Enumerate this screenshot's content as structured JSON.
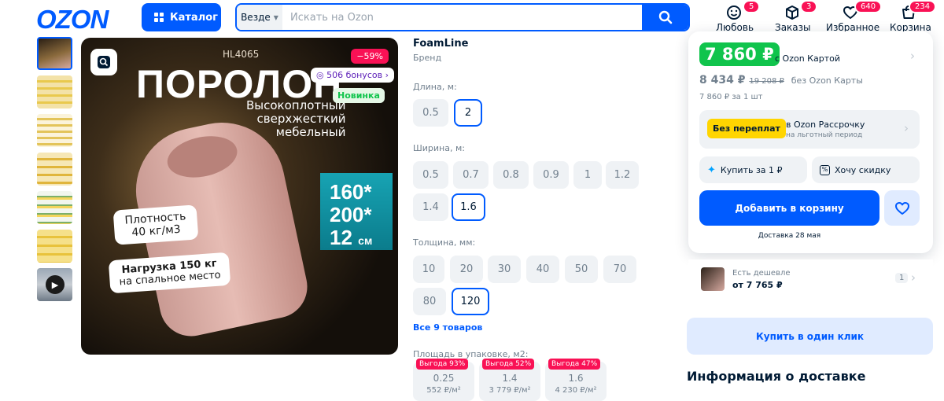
{
  "header": {
    "logo": "OZON",
    "catalog_label": "Каталог",
    "search_scope": "Везде",
    "search_placeholder": "Искать на Ozon",
    "actions": [
      {
        "label": "Любовь",
        "badge": "5",
        "icon": "smile-icon"
      },
      {
        "label": "Заказы",
        "badge": "3",
        "icon": "box-icon"
      },
      {
        "label": "Избранное",
        "badge": "640",
        "icon": "heart-icon"
      },
      {
        "label": "Корзина",
        "badge": "234",
        "icon": "cart-icon"
      }
    ]
  },
  "hero": {
    "code": "HL4065",
    "title": "ПОРОЛОН",
    "subtitle_1": "Высокоплотный",
    "subtitle_2": "сверхжесткий",
    "subtitle_3": "мебельный",
    "discount": "−59%",
    "bonus": "506 бонусов",
    "novelty": "Новинка",
    "size_1": "160",
    "size_2": "200",
    "size_3": "12",
    "size_unit": "см",
    "density_1": "Плотность",
    "density_2": "40 кг/м3",
    "load_1": "Нагрузка 150 кг",
    "load_2": "на спальное место"
  },
  "product": {
    "brand": "FoamLine",
    "brand_label": "Бренд",
    "length_label": "Длина, м:",
    "length_options": [
      "0.5",
      "2"
    ],
    "width_label": "Ширина, м:",
    "width_options": [
      "0.5",
      "0.7",
      "0.8",
      "0.9",
      "1",
      "1.2",
      "1.4",
      "1.6"
    ],
    "thickness_label": "Толщина, мм:",
    "thickness_options": [
      "10",
      "20",
      "30",
      "40",
      "50",
      "70",
      "80",
      "120"
    ],
    "all_items": "Все 9 товаров",
    "package_label": "Площадь в упаковке, м2:",
    "packages": [
      {
        "deal": "Выгода 93%",
        "value": "0.25",
        "price": "552 ₽/м²"
      },
      {
        "deal": "Выгода 52%",
        "value": "1.4",
        "price": "3 779 ₽/м²"
      },
      {
        "deal": "Выгода 47%",
        "value": "1.6",
        "price": "4 230 ₽/м²"
      }
    ]
  },
  "buy": {
    "price": "7 860 ₽",
    "price_note": "с Ozon Картой",
    "old_price": "8 434 ₽",
    "crossed_price": "19 208 ₽",
    "old_note": "без Ozon Карты",
    "per_unit": "7 860 ₽ за 1 шт",
    "no_overpay": "Без переплат",
    "installment_title": "в Ozon Рассрочку",
    "installment_sub": "на льготный период",
    "buy_for_1": "Купить за 1 ₽",
    "want_discount": "Хочу скидку",
    "add_to_cart": "Добавить в корзину",
    "delivery": "Доставка 28 мая",
    "cheaper_label": "Есть дешевле",
    "cheaper_price": "от 7 765 ₽",
    "cheaper_count": "1",
    "one_click": "Купить в один клик",
    "delivery_info_title": "Информация о доставке"
  }
}
